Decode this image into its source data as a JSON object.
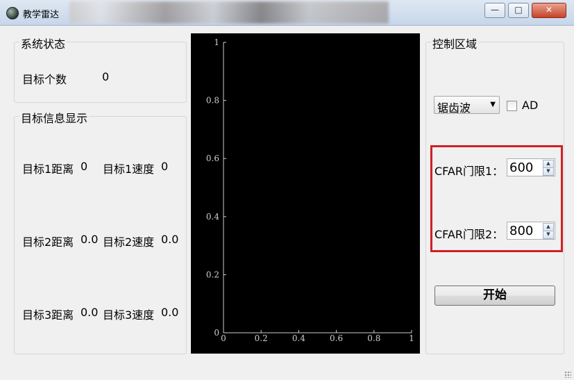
{
  "window": {
    "title": "教学雷达",
    "min_icon": "minimize-icon",
    "max_icon": "maximize-icon",
    "close_icon": "close-icon",
    "min_glyph": "—",
    "max_glyph": "□",
    "close_glyph": "✕"
  },
  "status": {
    "title": "系统状态",
    "count_label": "目标个数",
    "count_value": "0"
  },
  "targets": {
    "title": "目标信息显示",
    "rows": [
      {
        "dist_label": "目标1距离",
        "dist_value": "0",
        "speed_label": "目标1速度",
        "speed_value": "0"
      },
      {
        "dist_label": "目标2距离",
        "dist_value": "0.0",
        "speed_label": "目标2速度",
        "speed_value": "0.0"
      },
      {
        "dist_label": "目标3距离",
        "dist_value": "0.0",
        "speed_label": "目标3速度",
        "speed_value": "0.0"
      }
    ]
  },
  "plot": {
    "background": "#000000",
    "y_ticks": [
      "0",
      "0.2",
      "0.4",
      "0.6",
      "0.8",
      "1"
    ],
    "x_ticks": [
      "0",
      "0.2",
      "0.4",
      "0.6",
      "0.8",
      "1"
    ]
  },
  "control": {
    "title": "控制区域",
    "waveform_selected": "锯齿波",
    "ad_label": "AD",
    "ad_checked": false,
    "cfar1_label": "CFAR门限1：",
    "cfar1_value": "600",
    "cfar2_label": "CFAR门限2：",
    "cfar2_value": "800",
    "start_label": "开始",
    "highlight_color": "#d01f26"
  }
}
